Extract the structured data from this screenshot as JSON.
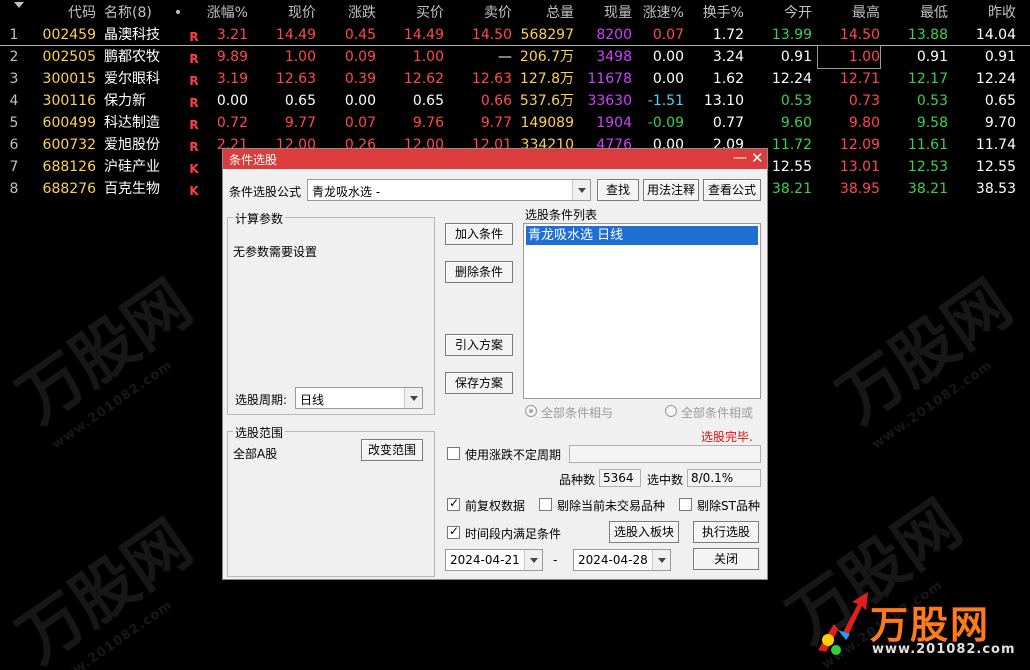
{
  "table": {
    "headers": {
      "code": "代码",
      "name": "名称(8)",
      "dot": "•",
      "change_pct": "涨幅%",
      "price": "现价",
      "change": "涨跌",
      "buy": "买价",
      "sell": "卖价",
      "volume": "总量",
      "current": "现量",
      "speed": "涨速%",
      "turnover": "换手%",
      "open": "今开",
      "high": "最高",
      "low": "最低",
      "prev_close": "昨收"
    },
    "rows": [
      {
        "idx": "1",
        "code": "002459",
        "name": "晶澳科技",
        "flag": "R",
        "change_pct": "3.21",
        "price": "14.49",
        "change": "0.45",
        "buy": "14.49",
        "sell": "14.50",
        "volume": "568297",
        "current": "8200",
        "speed": "0.07",
        "turnover": "1.72",
        "open": "13.99",
        "high": "14.50",
        "low": "13.88",
        "prev_close": "14.04"
      },
      {
        "idx": "2",
        "code": "002505",
        "name": "鹏都农牧",
        "flag": "R",
        "change_pct": "9.89",
        "price": "1.00",
        "change": "0.09",
        "buy": "1.00",
        "sell": "—",
        "volume": "206.7万",
        "current": "3498",
        "speed": "0.00",
        "turnover": "3.24",
        "open": "0.91",
        "high": "1.00",
        "low": "0.91",
        "prev_close": "0.91"
      },
      {
        "idx": "3",
        "code": "300015",
        "name": "爱尔眼科",
        "flag": "R",
        "change_pct": "3.19",
        "price": "12.63",
        "change": "0.39",
        "buy": "12.62",
        "sell": "12.63",
        "volume": "127.8万",
        "current": "11678",
        "speed": "0.00",
        "turnover": "1.62",
        "open": "12.24",
        "high": "12.71",
        "low": "12.17",
        "prev_close": "12.24"
      },
      {
        "idx": "4",
        "code": "300116",
        "name": "保力新",
        "flag": "R",
        "change_pct": "0.00",
        "price": "0.65",
        "change": "0.00",
        "buy": "0.65",
        "sell": "0.66",
        "volume": "537.6万",
        "current": "33630",
        "speed": "-1.51",
        "turnover": "13.10",
        "open": "0.53",
        "high": "0.73",
        "low": "0.53",
        "prev_close": "0.65"
      },
      {
        "idx": "5",
        "code": "600499",
        "name": "科达制造",
        "flag": "R",
        "change_pct": "0.72",
        "price": "9.77",
        "change": "0.07",
        "buy": "9.76",
        "sell": "9.77",
        "volume": "149089",
        "current": "1904",
        "speed": "-0.09",
        "turnover": "0.77",
        "open": "9.60",
        "high": "9.80",
        "low": "9.58",
        "prev_close": "9.70"
      },
      {
        "idx": "6",
        "code": "600732",
        "name": "爱旭股份",
        "flag": "R",
        "change_pct": "2.21",
        "price": "12.00",
        "change": "0.26",
        "buy": "12.00",
        "sell": "12.01",
        "volume": "334210",
        "current": "4776",
        "speed": "0.00",
        "turnover": "2.09",
        "open": "11.72",
        "high": "12.09",
        "low": "11.61",
        "prev_close": "11.74"
      },
      {
        "idx": "7",
        "code": "688126",
        "name": "沪硅产业",
        "flag": "K",
        "change_pct": "",
        "price": "",
        "change": "",
        "buy": "",
        "sell": "",
        "volume": "",
        "current": "",
        "speed": "",
        "turnover": "",
        "open": "12.55",
        "high": "13.01",
        "low": "12.53",
        "prev_close": "12.55"
      },
      {
        "idx": "8",
        "code": "688276",
        "name": "百克生物",
        "flag": "K",
        "change_pct": "",
        "price": "",
        "change": "",
        "buy": "",
        "sell": "",
        "volume": "",
        "current": "",
        "speed": "",
        "turnover": "",
        "open": "38.21",
        "high": "38.95",
        "low": "38.21",
        "prev_close": "38.53"
      }
    ]
  },
  "watermark": {
    "text": "万股网",
    "url": "www.201082.com"
  },
  "logo": {
    "text": "万股网",
    "url": "www.201082.com"
  },
  "dialog": {
    "title": "条件选股",
    "minimize": "—",
    "close": "✕",
    "formula_label": "条件选股公式",
    "formula_value": "青龙吸水选  -",
    "find_button": "查找",
    "usage_button": "用法注释",
    "view_button": "查看公式",
    "params_group": "计算参数",
    "params_text": "无参数需要设置",
    "period_label": "选股周期:",
    "period_value": "日线",
    "add_button": "加入条件",
    "delete_button": "删除条件",
    "import_button": "引入方案",
    "save_button": "保存方案",
    "list_title": "选股条件列表",
    "list_items": [
      "青龙吸水选  日线"
    ],
    "radio_and": "全部条件相与",
    "radio_or": "全部条件相或",
    "status": "选股完毕.",
    "range_group": "选股范围",
    "range_value": "全部A股",
    "change_range_button": "改变范围",
    "uncertain_period": "使用涨跌不定周期",
    "count_label": "品种数",
    "count_value": "5364",
    "selected_label": "选中数",
    "selected_value": "8/0.1%",
    "forward_adjust": "前复权数据",
    "exclude_nontrade": "剔除当前未交易品种",
    "exclude_st": "剔除ST品种",
    "time_condition": "时间段内满足条件",
    "to_block_button": "选股入板块",
    "execute_button": "执行选股",
    "date_from": "2024-04-21",
    "date_sep": "-",
    "date_to": "2024-04-28",
    "close_button": "关闭"
  }
}
